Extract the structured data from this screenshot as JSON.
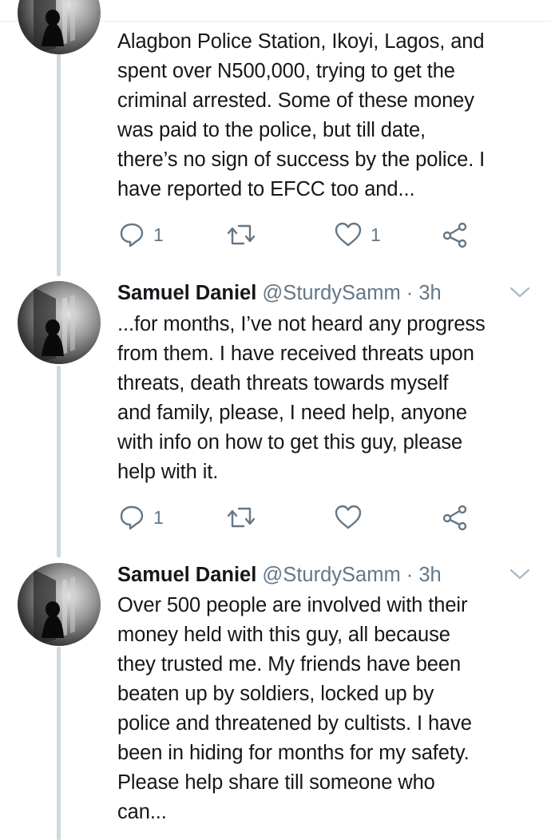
{
  "tweets": [
    {
      "text": "Alagbon Police Station, Ikoyi, Lagos, and\nspent over N500,000, trying to get the\ncriminal arrested. Some of these money\nwas paid to the police, but till date,\nthere’s no sign of success by the police. I\nhave reported to EFCC too and...",
      "reply_count": "1",
      "like_count": "1"
    },
    {
      "author_name": "Samuel Daniel",
      "author_handle": "@SturdySamm",
      "separator": "·",
      "time": "3h",
      "text": "...for months, I’ve not heard any progress\nfrom them. I have received threats upon\nthreats, death threats towards myself\nand family, please, I need help, anyone\nwith info on how to get this guy, please\nhelp with it.",
      "reply_count": "1",
      "like_count": ""
    },
    {
      "author_name": "Samuel Daniel",
      "author_handle": "@SturdySamm",
      "separator": "·",
      "time": "3h",
      "text": "Over 500 people are involved with their\nmoney held with this guy, all because\nthey trusted me. My friends have been\nbeaten up by soldiers, locked up by\npolice and threatened by cultists. I have\nbeen in hiding for months for my safety.\nPlease help share till someone who\ncan..."
    }
  ],
  "icons": {
    "reply": "reply-icon",
    "retweet": "retweet-icon",
    "like": "heart-icon",
    "share": "share-icon",
    "more": "chevron-down-icon"
  },
  "colors": {
    "text": "#14171a",
    "secondary": "#657786",
    "thread_line": "#cfd9de"
  }
}
